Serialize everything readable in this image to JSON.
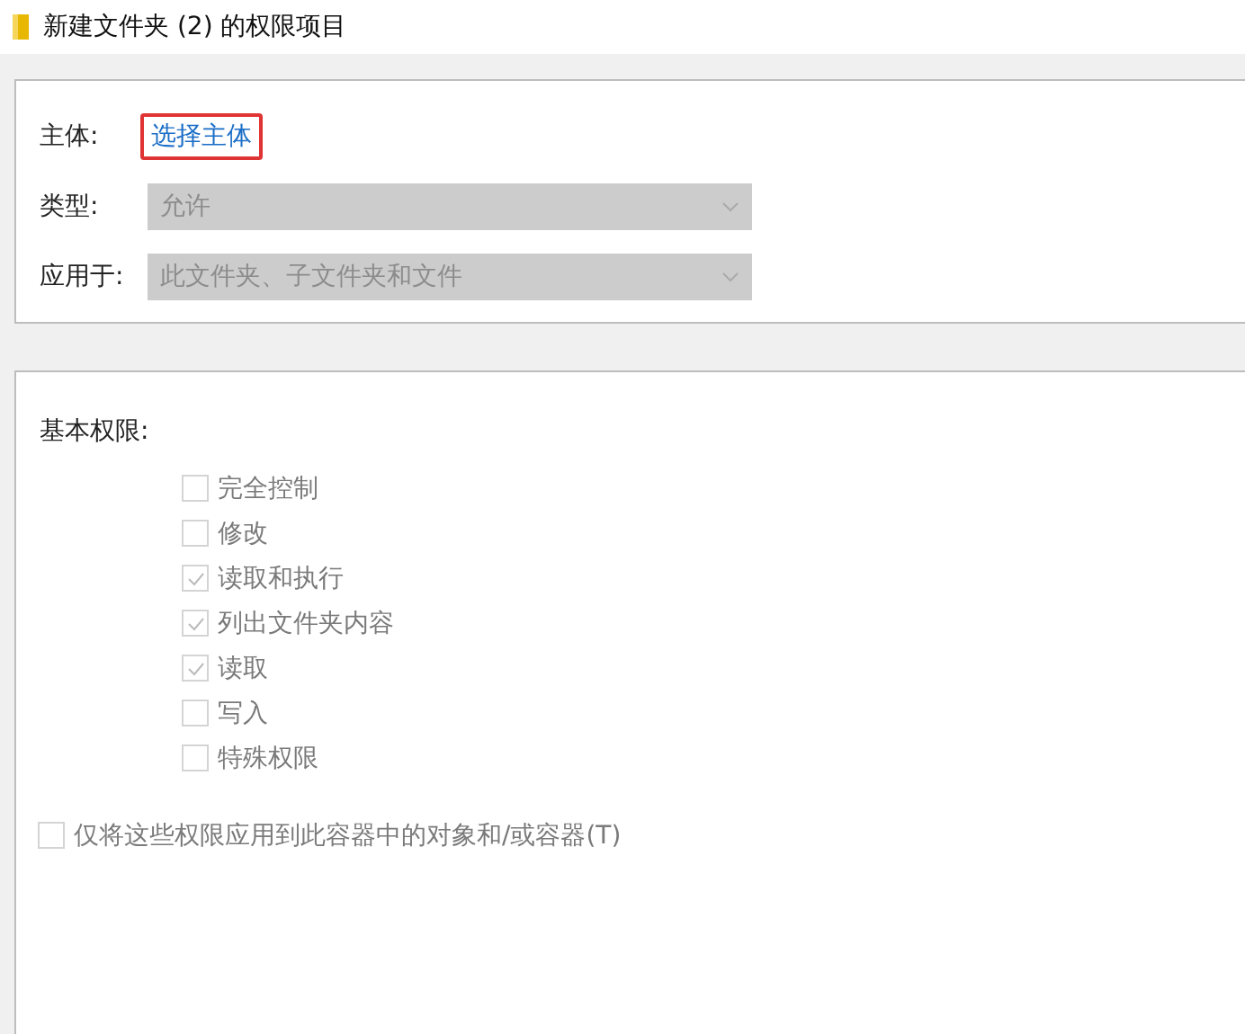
{
  "window": {
    "title": "新建文件夹 (2) 的权限项目"
  },
  "principal": {
    "label": "主体:",
    "link": "选择主体",
    "highlighted": true
  },
  "fields": [
    {
      "label": "类型:",
      "value": "允许",
      "disabled": true
    },
    {
      "label": "应用于:",
      "value": "此文件夹、子文件夹和文件",
      "disabled": true
    }
  ],
  "permissions": {
    "heading": "基本权限:",
    "items": [
      {
        "label": "完全控制",
        "checked": false,
        "disabled": true
      },
      {
        "label": "修改",
        "checked": false,
        "disabled": true
      },
      {
        "label": "读取和执行",
        "checked": true,
        "disabled": true
      },
      {
        "label": "列出文件夹内容",
        "checked": true,
        "disabled": true
      },
      {
        "label": "读取",
        "checked": true,
        "disabled": true
      },
      {
        "label": "写入",
        "checked": false,
        "disabled": true
      },
      {
        "label": "特殊权限",
        "checked": false,
        "disabled": true
      }
    ]
  },
  "apply_only": {
    "label": "仅将这些权限应用到此容器中的对象和/或容器(T)",
    "checked": false,
    "disabled": true
  }
}
